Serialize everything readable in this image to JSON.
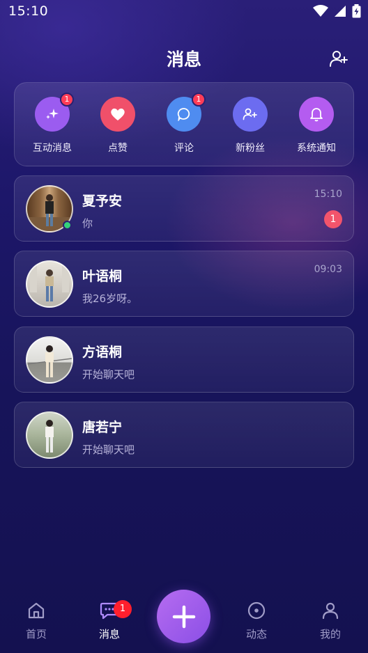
{
  "status_bar": {
    "time": "15:10"
  },
  "header": {
    "title": "消息",
    "add_friend_icon": "user-plus-icon"
  },
  "shortcuts": [
    {
      "label": "互动消息",
      "icon": "sparkle-icon",
      "badge": "1",
      "color": "#9b5cf0"
    },
    {
      "label": "点赞",
      "icon": "heart-icon",
      "badge": "",
      "color": "#f0506a"
    },
    {
      "label": "评论",
      "icon": "chat-bubble-icon",
      "badge": "1",
      "color": "#4f8cf0"
    },
    {
      "label": "新粉丝",
      "icon": "user-plus-icon",
      "badge": "",
      "color": "#6c6cf0"
    },
    {
      "label": "系统通知",
      "icon": "bell-icon",
      "badge": "",
      "color": "#b45cf0"
    }
  ],
  "chats": [
    {
      "name": "夏予安",
      "preview": "你",
      "time": "15:10",
      "unread": "1",
      "online": true
    },
    {
      "name": "叶语桐",
      "preview": "我26岁呀。",
      "time": "09:03",
      "unread": "",
      "online": false
    },
    {
      "name": "方语桐",
      "preview": "开始聊天吧",
      "time": "",
      "unread": "",
      "online": false
    },
    {
      "name": "唐若宁",
      "preview": "开始聊天吧",
      "time": "",
      "unread": "",
      "online": false
    }
  ],
  "bottom_nav": {
    "items": [
      {
        "label": "首页",
        "icon": "home-icon"
      },
      {
        "label": "消息",
        "icon": "message-icon",
        "badge": "1",
        "active": true
      },
      {
        "label": "动态",
        "icon": "explore-icon"
      },
      {
        "label": "我的",
        "icon": "profile-icon"
      }
    ],
    "fab_icon": "plus-icon"
  }
}
